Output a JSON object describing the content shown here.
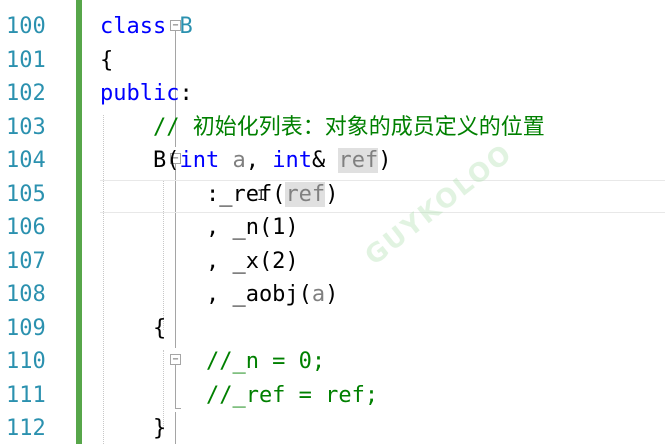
{
  "editor": {
    "line_numbers": [
      "100",
      "101",
      "102",
      "103",
      "104",
      "105",
      "106",
      "107",
      "108",
      "109",
      "110",
      "111",
      "112"
    ],
    "lines": [
      [
        {
          "t": "class ",
          "c": "kw"
        },
        {
          "t": "B",
          "c": "type"
        }
      ],
      [
        {
          "t": "{",
          "c": "plain"
        }
      ],
      [
        {
          "t": "public",
          "c": "kw"
        },
        {
          "t": ":",
          "c": "plain"
        }
      ],
      [
        {
          "t": "    // 初始化列表：对象的成员定义的位置",
          "c": "comment"
        }
      ],
      [
        {
          "t": "    B(",
          "c": "plain"
        },
        {
          "t": "int",
          "c": "kw"
        },
        {
          "t": " ",
          "c": "plain"
        },
        {
          "t": "a",
          "c": "param"
        },
        {
          "t": ", ",
          "c": "plain"
        },
        {
          "t": "int",
          "c": "kw"
        },
        {
          "t": "& ",
          "c": "plain"
        },
        {
          "t": "ref",
          "c": "param hl"
        },
        {
          "t": ")",
          "c": "plain"
        }
      ],
      [
        {
          "t": "        :_ref(",
          "c": "plain"
        },
        {
          "t": "ref",
          "c": "param hl"
        },
        {
          "t": ")",
          "c": "plain"
        }
      ],
      [
        {
          "t": "        , _n(1)",
          "c": "plain"
        }
      ],
      [
        {
          "t": "        , _x(2)",
          "c": "plain"
        }
      ],
      [
        {
          "t": "        , _aobj(",
          "c": "plain"
        },
        {
          "t": "a",
          "c": "param"
        },
        {
          "t": ")",
          "c": "plain"
        }
      ],
      [
        {
          "t": "    {",
          "c": "plain"
        }
      ],
      [
        {
          "t": "        //_n = 0;",
          "c": "comment"
        }
      ],
      [
        {
          "t": "        //_ref = ref;",
          "c": "comment"
        }
      ],
      [
        {
          "t": "    }",
          "c": "plain"
        }
      ]
    ],
    "fold_glyph": "−",
    "cursor_glyph": "I"
  },
  "colors": {
    "keyword": "#0000ff",
    "type": "#2b91af",
    "comment": "#008000",
    "parameter": "#808080",
    "line_number": "#2b91af",
    "change_bar": "#57a64a"
  }
}
